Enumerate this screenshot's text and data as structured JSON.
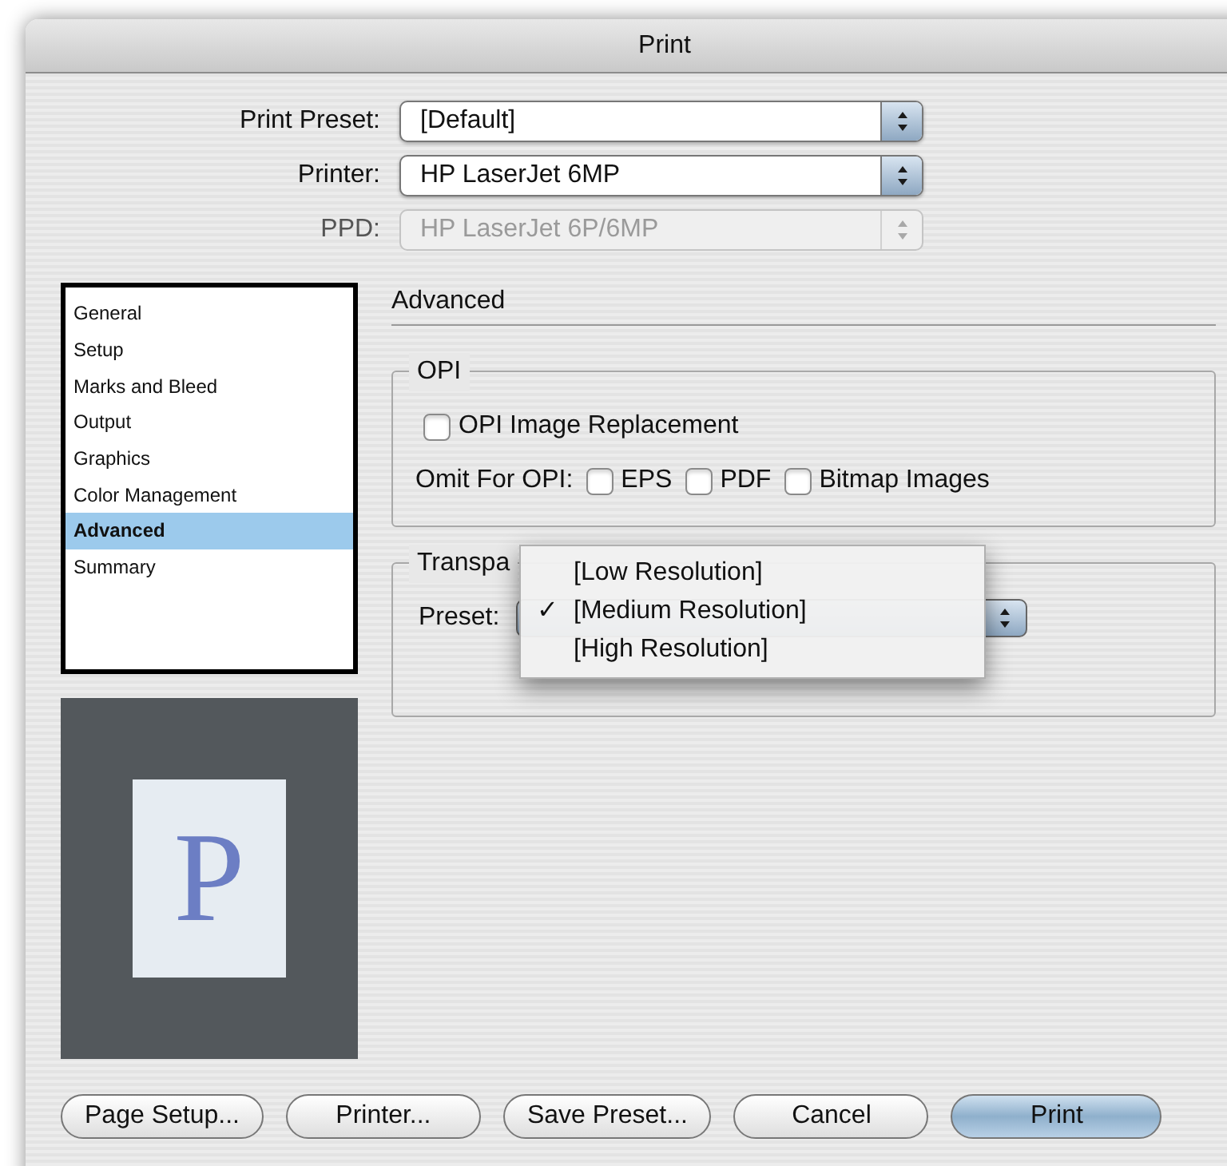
{
  "window": {
    "title": "Print"
  },
  "fields": [
    {
      "label": "Print Preset:",
      "value": "[Default]",
      "disabled": false
    },
    {
      "label": "Printer:",
      "value": "HP LaserJet 6MP",
      "disabled": false
    },
    {
      "label": "PPD:",
      "value": "HP LaserJet 6P/6MP",
      "disabled": true
    }
  ],
  "sidebar": {
    "items": [
      {
        "label": "General",
        "selected": false
      },
      {
        "label": "Setup",
        "selected": false
      },
      {
        "label": "Marks and Bleed",
        "selected": false
      },
      {
        "label": "Output",
        "selected": false
      },
      {
        "label": "Graphics",
        "selected": false
      },
      {
        "label": "Color Management",
        "selected": false
      },
      {
        "label": "Advanced",
        "selected": true
      },
      {
        "label": "Summary",
        "selected": false
      }
    ]
  },
  "preview": {
    "letter": "P"
  },
  "section_title": "Advanced",
  "opi": {
    "title": "OPI",
    "replacement": {
      "label": "OPI Image Replacement",
      "checked": false
    },
    "omit_label": "Omit For OPI:",
    "omit": [
      {
        "label": "EPS",
        "checked": false
      },
      {
        "label": "PDF",
        "checked": false
      },
      {
        "label": "Bitmap Images",
        "checked": false
      }
    ]
  },
  "flattener": {
    "title": "Transpa",
    "preset_label": "Preset:"
  },
  "menu": {
    "check_mark": "✓",
    "items": [
      {
        "label": "[Low Resolution]",
        "selected": false
      },
      {
        "label": "[Medium Resolution]",
        "selected": true
      },
      {
        "label": "[High Resolution]",
        "selected": false
      }
    ]
  },
  "buttons": [
    {
      "label": "Page Setup...",
      "default": false
    },
    {
      "label": "Printer...",
      "default": false
    },
    {
      "label": "Save Preset...",
      "default": false
    },
    {
      "label": "Cancel",
      "default": false
    },
    {
      "label": "Print",
      "default": true
    }
  ]
}
